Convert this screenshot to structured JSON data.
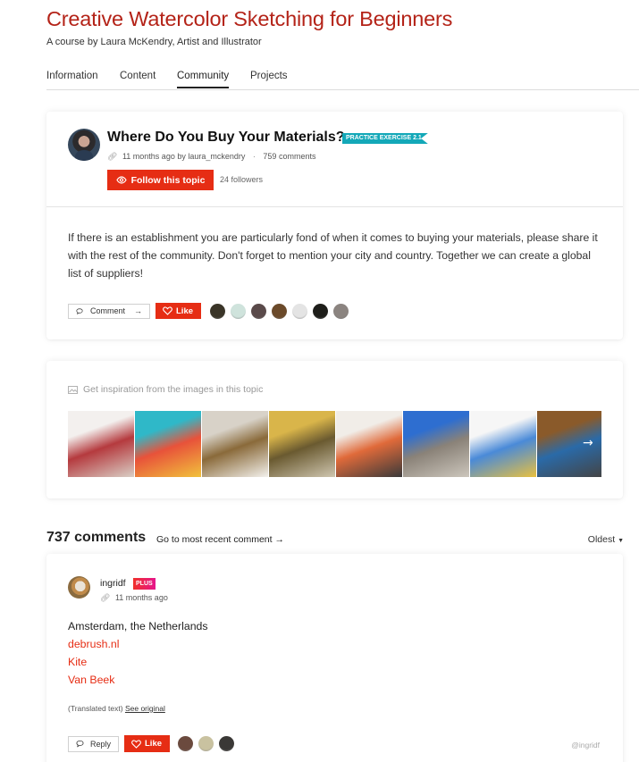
{
  "course": {
    "title": "Creative Watercolor Sketching for Beginners",
    "subtitle_prefix": "A course by ",
    "author": "Laura McKendry",
    "subtitle_suffix": ", Artist and Illustrator"
  },
  "tabs": [
    {
      "label": "Information",
      "active": false
    },
    {
      "label": "Content",
      "active": false
    },
    {
      "label": "Community",
      "active": true
    },
    {
      "label": "Projects",
      "active": false
    }
  ],
  "topic": {
    "title": "Where Do You Buy Your Materials?",
    "badge": "PRACTICE EXERCISE 2.1",
    "time": "11 months ago by",
    "author": "laura_mckendry",
    "comments": "759 comments",
    "follow_label": "Follow this topic",
    "followers": "24 followers",
    "body": "If there is an establishment you are particularly fond of when it comes to buying your materials, please share it with the rest of the community. Don't forget to mention your city and country. Together we can create a global list of suppliers!",
    "comment_label": "Comment",
    "like_label": "Like",
    "likers": [
      "#3a3528",
      "#cfe3dc",
      "#5a4a4a",
      "#6b4a2a",
      "#e4e4e4",
      "#1e1e1a",
      "#8b8480"
    ]
  },
  "inspiration": {
    "label": "Get inspiration from the images in this topic",
    "images": [
      {
        "name": "shop-storefront",
        "colors": [
          "#f3f0ee",
          "#b53a3e",
          "#d9cfc6"
        ]
      },
      {
        "name": "colorful-paint-drips",
        "colors": [
          "#2fb8c8",
          "#e8523a",
          "#f1c23c"
        ]
      },
      {
        "name": "brushes-in-rinse-cup",
        "colors": [
          "#d8d2c8",
          "#8a6a3a",
          "#f3f1ec"
        ]
      },
      {
        "name": "yellow-building",
        "colors": [
          "#d9b54a",
          "#6a5a30",
          "#cfc6b0"
        ]
      },
      {
        "name": "palette-and-brushes",
        "colors": [
          "#f1ede8",
          "#e06a3a",
          "#3a3a3a"
        ]
      },
      {
        "name": "gachem-store",
        "colors": [
          "#2e6ed0",
          "#8a8278",
          "#ccc6bc"
        ]
      },
      {
        "name": "watercolor-set-app",
        "colors": [
          "#f6f6f6",
          "#4a8ad8",
          "#e8c040"
        ]
      },
      {
        "name": "paint-pans-on-wood",
        "colors": [
          "#8a5a2a",
          "#2a6aa8",
          "#444444"
        ]
      }
    ]
  },
  "comments_section": {
    "count_label": "737 comments",
    "goto_recent": "Go to most recent comment →",
    "sort": "Oldest"
  },
  "comment": {
    "user": "ingridf",
    "badge": "PLUS",
    "time": "11 months ago",
    "location": "Amsterdam, the Netherlands",
    "shops": [
      "debrush.nl",
      "Kite",
      "Van Beek"
    ],
    "translated_label": "(Translated text)",
    "see_original": "See original",
    "reply_label": "Reply",
    "like_label": "Like",
    "likers": [
      "#6b4a3e",
      "#c9c2a0",
      "#3a3836"
    ],
    "handle": "@ingridf"
  },
  "colors": {
    "accent": "#e62d14",
    "title": "#b42318",
    "badge_teal": "#13a8b8"
  }
}
